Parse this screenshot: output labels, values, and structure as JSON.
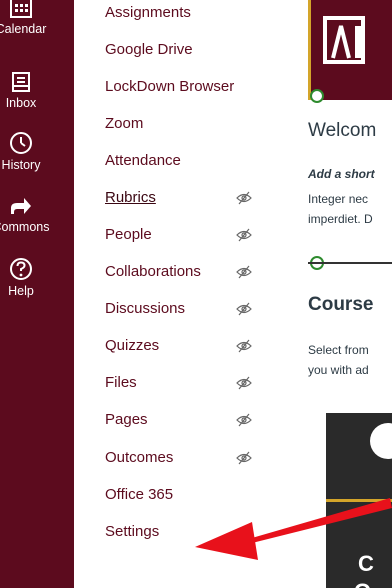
{
  "global_nav": {
    "items": [
      {
        "label": "Calendar",
        "icon": "calendar-icon"
      },
      {
        "label": "Inbox",
        "icon": "inbox-icon"
      },
      {
        "label": "History",
        "icon": "history-icon"
      },
      {
        "label": "Commons",
        "icon": "commons-icon"
      },
      {
        "label": "Help",
        "icon": "help-icon"
      }
    ]
  },
  "course_nav": {
    "items": [
      {
        "label": "Assignments",
        "hidden": false
      },
      {
        "label": "Google Drive",
        "hidden": false
      },
      {
        "label": "LockDown Browser",
        "hidden": false
      },
      {
        "label": "Zoom",
        "hidden": false
      },
      {
        "label": "Attendance",
        "hidden": false
      },
      {
        "label": "Rubrics",
        "hidden": true
      },
      {
        "label": "People",
        "hidden": true
      },
      {
        "label": "Collaborations",
        "hidden": true
      },
      {
        "label": "Discussions",
        "hidden": true
      },
      {
        "label": "Quizzes",
        "hidden": true
      },
      {
        "label": "Files",
        "hidden": true
      },
      {
        "label": "Pages",
        "hidden": true
      },
      {
        "label": "Outcomes",
        "hidden": true
      },
      {
        "label": "Office 365",
        "hidden": false
      },
      {
        "label": "Settings",
        "hidden": false
      }
    ]
  },
  "content": {
    "welcome_heading": "Welcom",
    "intro_label": "Add a short",
    "body_line1": "Integer nec",
    "body_line2": "imperdiet. D",
    "course_heading": "Course",
    "select_line1": "Select from",
    "select_line2": "you with ad",
    "promo_letter1": "C",
    "promo_letter2": "O"
  },
  "colors": {
    "nav_background": "#5c0b1e",
    "link": "#5c0b1e",
    "accent_gold": "#d4a52a",
    "arrow_red": "#e8111b"
  }
}
